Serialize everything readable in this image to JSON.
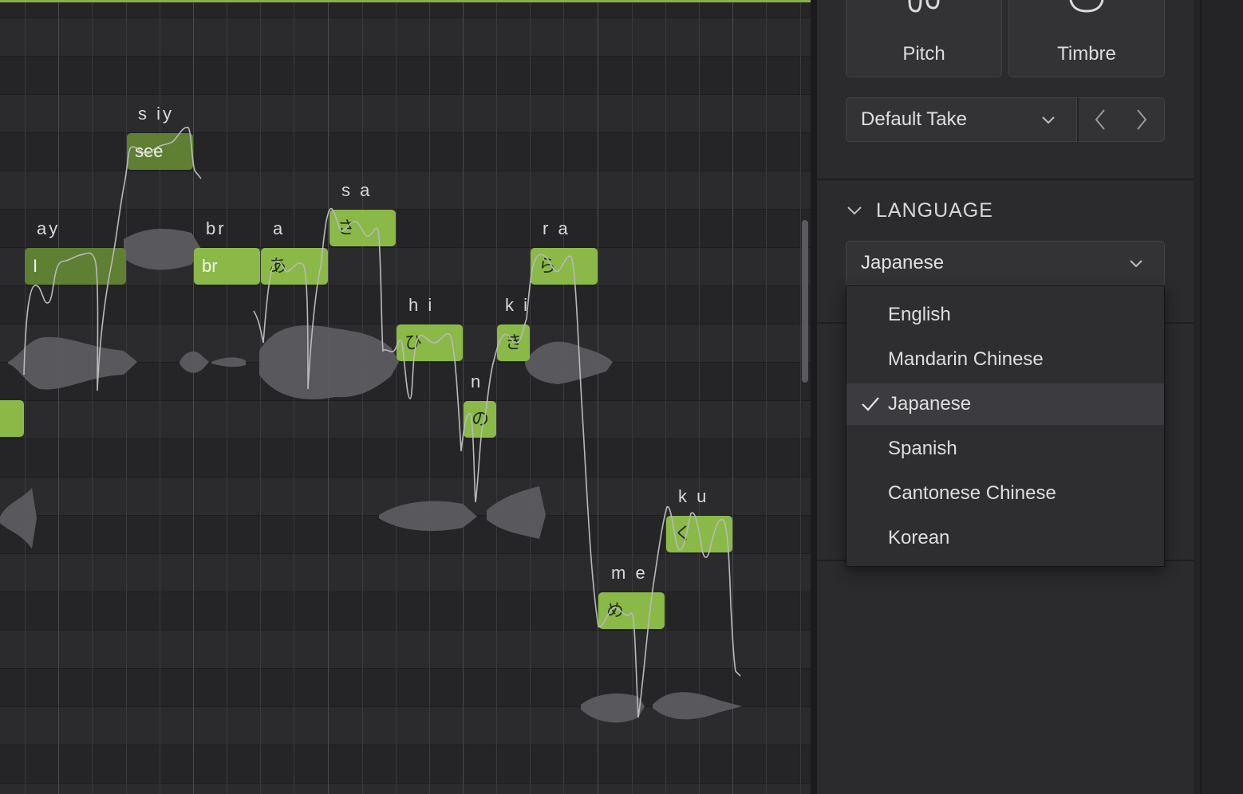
{
  "colors": {
    "note": "#8ab948",
    "note_dim": "#5f7f33",
    "accent_line": "#8ab04a",
    "panel": "#2b2b2d"
  },
  "notes": [
    {
      "lyric": "",
      "phoneme": ""
    },
    {
      "lyric": "I",
      "phoneme": "ay"
    },
    {
      "lyric": "see",
      "phoneme": "s iy"
    },
    {
      "lyric": "br",
      "phoneme": "br"
    },
    {
      "lyric": "あ",
      "phoneme": "a"
    },
    {
      "lyric": "さ",
      "phoneme": "s a"
    },
    {
      "lyric": "ひ",
      "phoneme": "h i"
    },
    {
      "lyric": "の",
      "phoneme": "n"
    },
    {
      "lyric": "き",
      "phoneme": "k i"
    },
    {
      "lyric": "ら",
      "phoneme": "r a"
    },
    {
      "lyric": "め",
      "phoneme": "m e"
    },
    {
      "lyric": "く",
      "phoneme": "k u"
    }
  ],
  "panel": {
    "tiles": [
      {
        "label": "Pitch",
        "icon": "pitch-icon"
      },
      {
        "label": "Timbre",
        "icon": "timbre-icon"
      }
    ],
    "take": {
      "value": "Default Take",
      "prev_icon": "chevron-left-icon",
      "next_icon": "chevron-right-icon"
    },
    "language": {
      "header": "LANGUAGE",
      "selected": "Japanese",
      "options": [
        "English",
        "Mandarin Chinese",
        "Japanese",
        "Spanish",
        "Cantonese Chinese",
        "Korean"
      ]
    }
  }
}
